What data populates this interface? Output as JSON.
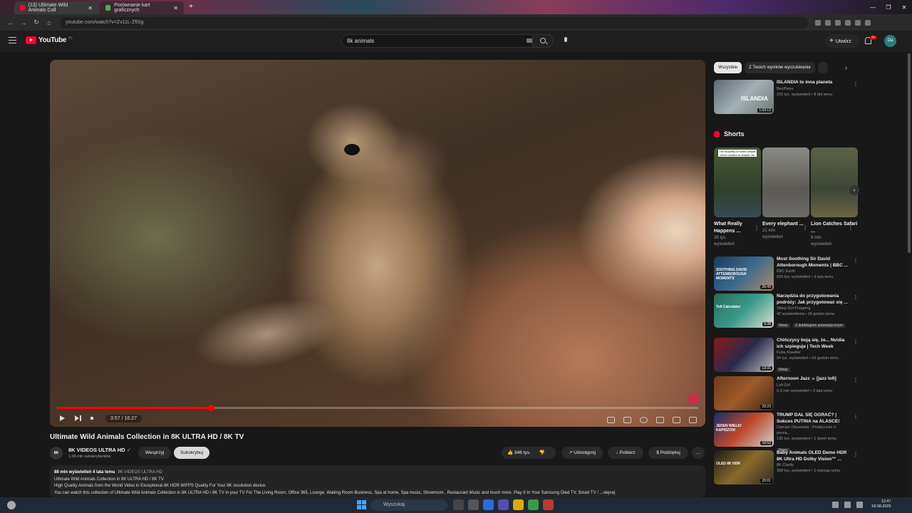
{
  "browser": {
    "tabs": [
      {
        "title": "(13) Ultimate Wild Animals Coll",
        "active": true
      },
      {
        "title": "Porównanie kart graficznych",
        "active": false
      }
    ],
    "new_tab": "+",
    "url": "youtube.com/watch?v=Zv11L-ZfiSg",
    "window_controls": [
      "—",
      "❐",
      "✕"
    ]
  },
  "youtube": {
    "logo_text": "YouTube",
    "logo_country": "PL",
    "search_value": "8k animals",
    "create_label": "Utwórz",
    "notification_count": "9+",
    "avatar_initials": "Da"
  },
  "player": {
    "time": "3:57 / 16:27",
    "progress_fraction": 0.24,
    "title": "Ultimate Wild Animals Collection in 8K ULTRA HD / 8K TV"
  },
  "channel": {
    "avatar_text": "8K",
    "name": "8K VIDEOS ULTRA HD",
    "subscribers": "1,09 mln subskrybentów",
    "support_label": "Wesprzyj",
    "subscribe_label": "Subskrybuj"
  },
  "actions": {
    "likes": "346 tys.",
    "share": "Udostępnij",
    "download": "Pobierz",
    "thanks": "Podziękuj",
    "more": "…"
  },
  "description": {
    "views_date": "88 mln wyświetleń  4 lata temu",
    "hashtag": "8K VIDEOS ULTRA HD",
    "lines": [
      "Ultimate Wild Animals Collection in 8K ULTRA HD / 8K TV",
      "High Quality Animals from the World Video in Exceptional 8K HDR 60FPS Quality For Your 8K resolution device.",
      "You can watch this collection of Ultimate Wild Animals Collection in 8K ULTRA HD / 8K TV in your TV For The Living Room, Office 365, Lounge, Waiting Room Business, Spa at home, Spa music, Showroom , Restaurant Music and much more. Play It In Your Samsung Oled TV, Smart TV !  ...więcej"
    ]
  },
  "sidebar": {
    "chips": [
      "Wszystkie",
      "Z Twoich wyników wyszukiwania",
      ""
    ],
    "first_video": {
      "title": "ISLANDIA to inna planeta",
      "channel": "BezPlanu",
      "meta": "225 tys. wyświetleń • 8 dni temu",
      "duration": "1:03:12",
      "thumb_label": "ISLANDIA"
    },
    "shorts_title": "Shorts",
    "shorts": [
      {
        "title": "What Really Happens ...",
        "meta1": "38 tys.",
        "meta2": "wyświetleń",
        "thumb_label": "The stupidity of some people never ceases to amaze me"
      },
      {
        "title": "Every elephant ...",
        "meta1": "21 mln",
        "meta2": "wyświetleń"
      },
      {
        "title": "Lion Catches Safari ...",
        "meta1": "9 mln",
        "meta2": "wyświetleń"
      }
    ],
    "videos": [
      {
        "title": "Most Soothing Sir David Attenborough Moments | BBC ...",
        "channel": "BBC Earth",
        "meta": "829 tys. wyświetleń • 3 lata temu",
        "duration": "26:49",
        "badge": "",
        "badge2": "",
        "thumb_label": "SOOTHING DAVID ATTENBOROUGH MOMENTS"
      },
      {
        "title": "Narzędzia do przygotowania podróży: Jak przygotować się ...",
        "channel": "Sklep Gol Prepping",
        "meta": "42 wyświetlenia • 18 godzin temu",
        "duration": "6:38",
        "badge": "Nowy",
        "badge2": "Z dubbingiem automatycznym",
        "thumb_label": "Toll Calculator"
      },
      {
        "title": "Chińczycy boją się, że... Nvidia ich szpieguje | Tech Week",
        "channel": "Kuba Klawiter",
        "meta": "94 tys. wyświetleń • 16 godzin temu",
        "duration": "13:31",
        "badge": "Nowy",
        "badge2": "",
        "thumb_label": ""
      },
      {
        "title": "Afternoon Jazz ☕ [jazz lofi]",
        "channel": "Lofi Girl",
        "meta": "6,9 mln wyświetleń • 2 lata temu",
        "duration": "29:23",
        "badge": "",
        "badge2": "",
        "thumb_label": ""
      },
      {
        "title": "TRUMP DAŁ SIĘ OGRAĆ? | Sukces PUTINA na ALASCE!",
        "channel": "Damian Olszewski - Praktycznie o pienią...",
        "meta": "135 tys. wyświetleń • 1 dzień temu",
        "duration": "16:52",
        "badge": "Nowy",
        "badge2": "",
        "thumb_label": "JEDEN WIELKI KAPISZON!"
      },
      {
        "title": "Baby Animals OLED Demo HDR 8K Ultra HD Dolby Vision™ ...",
        "channel": "8K Clarity",
        "meta": "398 tys. wyświetleń • 1 miesiąc temu",
        "duration": "20:01",
        "badge": "",
        "badge2": "",
        "thumb_label": "OLED 8K HDR"
      }
    ]
  },
  "taskbar": {
    "search_placeholder": "Wyszukaj",
    "time": "12:47",
    "date": "18.08.2025"
  },
  "colors": {
    "accent": "#ff0033",
    "progress": "#ff0000"
  }
}
